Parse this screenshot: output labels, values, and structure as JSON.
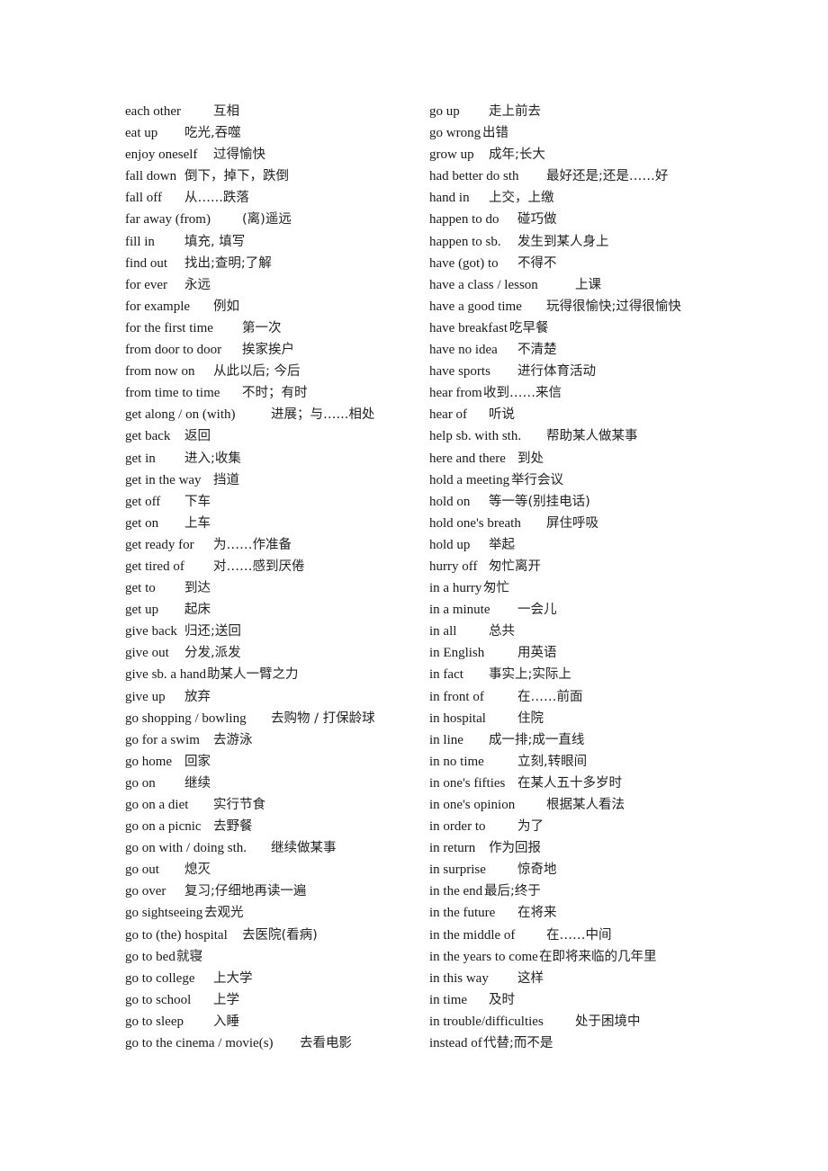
{
  "document": {
    "left_column": [
      {
        "phrase": "each other",
        "meaning": "互相"
      },
      {
        "phrase": "eat up",
        "meaning": "吃光,吞噬"
      },
      {
        "phrase": "enjoy oneself",
        "meaning": "过得愉快"
      },
      {
        "phrase": "fall down",
        "meaning": "倒下，掉下，跌倒"
      },
      {
        "phrase": "fall off",
        "meaning": "从…...跌落"
      },
      {
        "phrase": "far away (from)",
        "meaning": "(离)遥远"
      },
      {
        "phrase": "fill in",
        "meaning": "填充, 填写"
      },
      {
        "phrase": "find out",
        "meaning": "找出;查明;了解"
      },
      {
        "phrase": "for ever",
        "meaning": "永远"
      },
      {
        "phrase": "for example",
        "meaning": "例如"
      },
      {
        "phrase": "for the first time",
        "meaning": "第一次"
      },
      {
        "phrase": "from door to door",
        "meaning": "挨家挨户"
      },
      {
        "phrase": "from now on",
        "meaning": "从此以后; 今后"
      },
      {
        "phrase": "from time to time",
        "meaning": "不时；有时"
      },
      {
        "phrase": "get along / on (with)",
        "meaning": "进展；与…...相处"
      },
      {
        "phrase": "get back",
        "meaning": "返回"
      },
      {
        "phrase": "get in",
        "meaning": "进入;收集"
      },
      {
        "phrase": "get in the way",
        "meaning": "挡道"
      },
      {
        "phrase": "get off",
        "meaning": "下车"
      },
      {
        "phrase": "get on",
        "meaning": "上车"
      },
      {
        "phrase": "get ready for",
        "meaning": "为……作准备"
      },
      {
        "phrase": "get tired of",
        "meaning": "对……感到厌倦"
      },
      {
        "phrase": "get to",
        "meaning": "到达"
      },
      {
        "phrase": "get up",
        "meaning": "起床"
      },
      {
        "phrase": "give back",
        "meaning": "归还;送回"
      },
      {
        "phrase": "give out",
        "meaning": "分发,派发"
      },
      {
        "phrase": "give sb. a hand",
        "meaning": "助某人一臂之力"
      },
      {
        "phrase": "give up",
        "meaning": "放弃"
      },
      {
        "phrase": "go shopping / bowling",
        "meaning": "去购物 / 打保龄球"
      },
      {
        "phrase": "go for a swim",
        "meaning": "去游泳"
      },
      {
        "phrase": "go home",
        "meaning": "回家"
      },
      {
        "phrase": "go on",
        "meaning": "继续"
      },
      {
        "phrase": "go on a diet",
        "meaning": "实行节食"
      },
      {
        "phrase": "go on a picnic",
        "meaning": "去野餐"
      },
      {
        "phrase": "go on with / doing sth.",
        "meaning": "继续做某事"
      },
      {
        "phrase": "go out",
        "meaning": "熄灭"
      },
      {
        "phrase": "go over",
        "meaning": "复习;仔细地再读一遍"
      },
      {
        "phrase": "go sightseeing",
        "meaning": "去观光"
      },
      {
        "phrase": "go to (the) hospital",
        "meaning": "去医院(看病)"
      },
      {
        "phrase": "go to bed",
        "meaning": "就寝"
      },
      {
        "phrase": "go to college",
        "meaning": "上大学"
      },
      {
        "phrase": "go to school",
        "meaning": "上学"
      },
      {
        "phrase": "go to sleep",
        "meaning": "入睡"
      },
      {
        "phrase": "go to the cinema / movie(s)",
        "meaning": "去看电影"
      }
    ],
    "right_column": [
      {
        "phrase": "go up",
        "meaning": "走上前去"
      },
      {
        "phrase": "go wrong",
        "meaning": "出错"
      },
      {
        "phrase": "grow up",
        "meaning": "成年;长大"
      },
      {
        "phrase": "had better do sth",
        "meaning": "最好还是;还是……好"
      },
      {
        "phrase": "hand in",
        "meaning": "上交，上缴"
      },
      {
        "phrase": "happen to do",
        "meaning": "碰巧做"
      },
      {
        "phrase": "happen to sb.",
        "meaning": "发生到某人身上"
      },
      {
        "phrase": "have (got) to",
        "meaning": "不得不"
      },
      {
        "phrase": "have a class / lesson",
        "meaning": "上课"
      },
      {
        "phrase": "have a good time",
        "meaning": "玩得很愉快;过得很愉快"
      },
      {
        "phrase": "have breakfast",
        "meaning": "吃早餐"
      },
      {
        "phrase": "have no idea",
        "meaning": "不清楚"
      },
      {
        "phrase": "have sports",
        "meaning": "进行体育活动"
      },
      {
        "phrase": "hear from",
        "meaning": "收到……来信"
      },
      {
        "phrase": "hear of",
        "meaning": "听说"
      },
      {
        "phrase": "help sb. with sth.",
        "meaning": "帮助某人做某事"
      },
      {
        "phrase": "here and there",
        "meaning": "到处"
      },
      {
        "phrase": "hold a meeting",
        "meaning": "举行会议"
      },
      {
        "phrase": "hold on",
        "meaning": "等一等(别挂电话)"
      },
      {
        "phrase": "hold one's breath",
        "meaning": "屏住呼吸"
      },
      {
        "phrase": "hold up",
        "meaning": "举起"
      },
      {
        "phrase": "hurry off",
        "meaning": "匆忙离开"
      },
      {
        "phrase": "in a hurry",
        "meaning": "匆忙"
      },
      {
        "phrase": "in a minute",
        "meaning": "一会儿"
      },
      {
        "phrase": "in all",
        "meaning": "总共"
      },
      {
        "phrase": "in English",
        "meaning": "用英语"
      },
      {
        "phrase": "in fact",
        "meaning": "事实上;实际上"
      },
      {
        "phrase": "in front of",
        "meaning": "在……前面"
      },
      {
        "phrase": "in hospital",
        "meaning": "住院"
      },
      {
        "phrase": "in line",
        "meaning": "成一排;成一直线"
      },
      {
        "phrase": "in no time",
        "meaning": "立刻,转眼间"
      },
      {
        "phrase": "in one's fifties",
        "meaning": "在某人五十多岁时"
      },
      {
        "phrase": "in one's opinion",
        "meaning": "根据某人看法"
      },
      {
        "phrase": "in order to",
        "meaning": "为了"
      },
      {
        "phrase": "in return",
        "meaning": "作为回报"
      },
      {
        "phrase": "in surprise",
        "meaning": "惊奇地"
      },
      {
        "phrase": "in the end",
        "meaning": "最后;终于"
      },
      {
        "phrase": "in the future",
        "meaning": "在将来"
      },
      {
        "phrase": "in the middle of",
        "meaning": "在……中间"
      },
      {
        "phrase": "in the years to come",
        "meaning": "在即将来临的几年里"
      },
      {
        "phrase": "in this way",
        "meaning": "这样"
      },
      {
        "phrase": "in time",
        "meaning": "及时"
      },
      {
        "phrase": "in trouble/difficulties",
        "meaning": "处于困境中"
      },
      {
        "phrase": "instead of",
        "meaning": "代替;而不是"
      }
    ]
  }
}
